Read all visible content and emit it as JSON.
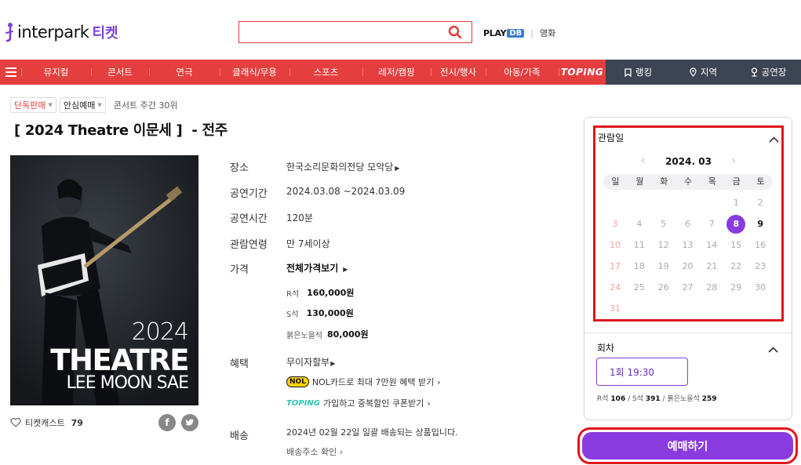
{
  "header": {
    "logo_text": "interpark",
    "logo_sub": "티켓",
    "search_placeholder": "",
    "play_label": "PLAY",
    "db_label": "DB",
    "movie_label": "영화"
  },
  "nav": {
    "items": [
      "뮤지컬",
      "콘서트",
      "연극",
      "클래식/무용",
      "스포츠",
      "레저/캠핑",
      "전시/행사",
      "아동/가족",
      "TOPING"
    ],
    "right_items": [
      "랭킹",
      "지역",
      "공연장"
    ]
  },
  "badges": {
    "exclusive": "단독판매",
    "safe": "안심예매",
    "rank": "콘서트 주간 30위"
  },
  "title": "[ 2024 Theatre 이문세 ]  - 전주",
  "poster": {
    "year": "2024",
    "main": "THEATRE",
    "name": "LEE MOON SAE"
  },
  "cast": {
    "label": "티켓캐스트",
    "count": "79"
  },
  "info": {
    "venue_label": "장소",
    "venue": "한국소리문화의전당 모악당",
    "period_label": "공연기간",
    "period": "2024.03.08 ~2024.03.09",
    "runtime_label": "공연시간",
    "runtime": "120분",
    "age_label": "관람연령",
    "age": "만 7세이상",
    "price_label": "가격",
    "price_all": "전체가격보기",
    "prices": [
      {
        "seat": "R석",
        "amount": "160,000원"
      },
      {
        "seat": "S석",
        "amount": "130,000원"
      },
      {
        "seat": "붉은노을석",
        "amount": "80,000원"
      }
    ],
    "benefit_label": "혜택",
    "benefit_main": "무이자할부",
    "nol_logo": "NOL",
    "nol_text": "NOL카드로 최대 7만원 혜택 받기",
    "toping_logo": "TOPING",
    "toping_text": "가입하고 중복할인 쿠폰받기",
    "delivery_label": "배송",
    "delivery_text": "2024년 02월 22일 일괄 배송되는 상품입니다.",
    "delivery_link": "배송주소 확인"
  },
  "calendar": {
    "header": "관람일",
    "month": "2024. 03",
    "weekdays": [
      "일",
      "월",
      "화",
      "수",
      "목",
      "금",
      "토"
    ],
    "days": [
      {
        "d": "1",
        "col": 5,
        "row": 0,
        "state": "disabled"
      },
      {
        "d": "2",
        "col": 6,
        "row": 0,
        "state": "disabled"
      },
      {
        "d": "3",
        "col": 0,
        "row": 1,
        "state": "sun"
      },
      {
        "d": "4",
        "col": 1,
        "row": 1,
        "state": "disabled"
      },
      {
        "d": "5",
        "col": 2,
        "row": 1,
        "state": "disabled"
      },
      {
        "d": "6",
        "col": 3,
        "row": 1,
        "state": "disabled"
      },
      {
        "d": "7",
        "col": 4,
        "row": 1,
        "state": "disabled"
      },
      {
        "d": "8",
        "col": 5,
        "row": 1,
        "state": "sel"
      },
      {
        "d": "9",
        "col": 6,
        "row": 1,
        "state": "open"
      },
      {
        "d": "10",
        "col": 0,
        "row": 2,
        "state": "sun"
      },
      {
        "d": "11",
        "col": 1,
        "row": 2,
        "state": "disabled"
      },
      {
        "d": "12",
        "col": 2,
        "row": 2,
        "state": "disabled"
      },
      {
        "d": "13",
        "col": 3,
        "row": 2,
        "state": "disabled"
      },
      {
        "d": "14",
        "col": 4,
        "row": 2,
        "state": "disabled"
      },
      {
        "d": "15",
        "col": 5,
        "row": 2,
        "state": "disabled"
      },
      {
        "d": "16",
        "col": 6,
        "row": 2,
        "state": "disabled"
      },
      {
        "d": "17",
        "col": 0,
        "row": 3,
        "state": "sun"
      },
      {
        "d": "18",
        "col": 1,
        "row": 3,
        "state": "disabled"
      },
      {
        "d": "19",
        "col": 2,
        "row": 3,
        "state": "disabled"
      },
      {
        "d": "20",
        "col": 3,
        "row": 3,
        "state": "disabled"
      },
      {
        "d": "21",
        "col": 4,
        "row": 3,
        "state": "disabled"
      },
      {
        "d": "22",
        "col": 5,
        "row": 3,
        "state": "disabled"
      },
      {
        "d": "23",
        "col": 6,
        "row": 3,
        "state": "disabled"
      },
      {
        "d": "24",
        "col": 0,
        "row": 4,
        "state": "sun"
      },
      {
        "d": "25",
        "col": 1,
        "row": 4,
        "state": "disabled"
      },
      {
        "d": "26",
        "col": 2,
        "row": 4,
        "state": "disabled"
      },
      {
        "d": "27",
        "col": 3,
        "row": 4,
        "state": "disabled"
      },
      {
        "d": "28",
        "col": 4,
        "row": 4,
        "state": "disabled"
      },
      {
        "d": "29",
        "col": 5,
        "row": 4,
        "state": "disabled"
      },
      {
        "d": "30",
        "col": 6,
        "row": 4,
        "state": "disabled"
      },
      {
        "d": "31",
        "col": 0,
        "row": 5,
        "state": "sun"
      }
    ]
  },
  "round": {
    "header": "회차",
    "button": "1회 19:30",
    "seats": [
      {
        "seat": "R석",
        "count": "106"
      },
      {
        "seat": "S석",
        "count": "391"
      },
      {
        "seat": "붉은노을석",
        "count": "259"
      }
    ]
  },
  "book_label": "예매하기",
  "colors": {
    "accent": "#8a3bdf",
    "nav_red": "#e53e3e",
    "nav_dark": "#3d4453",
    "highlight": "#e0161b"
  }
}
